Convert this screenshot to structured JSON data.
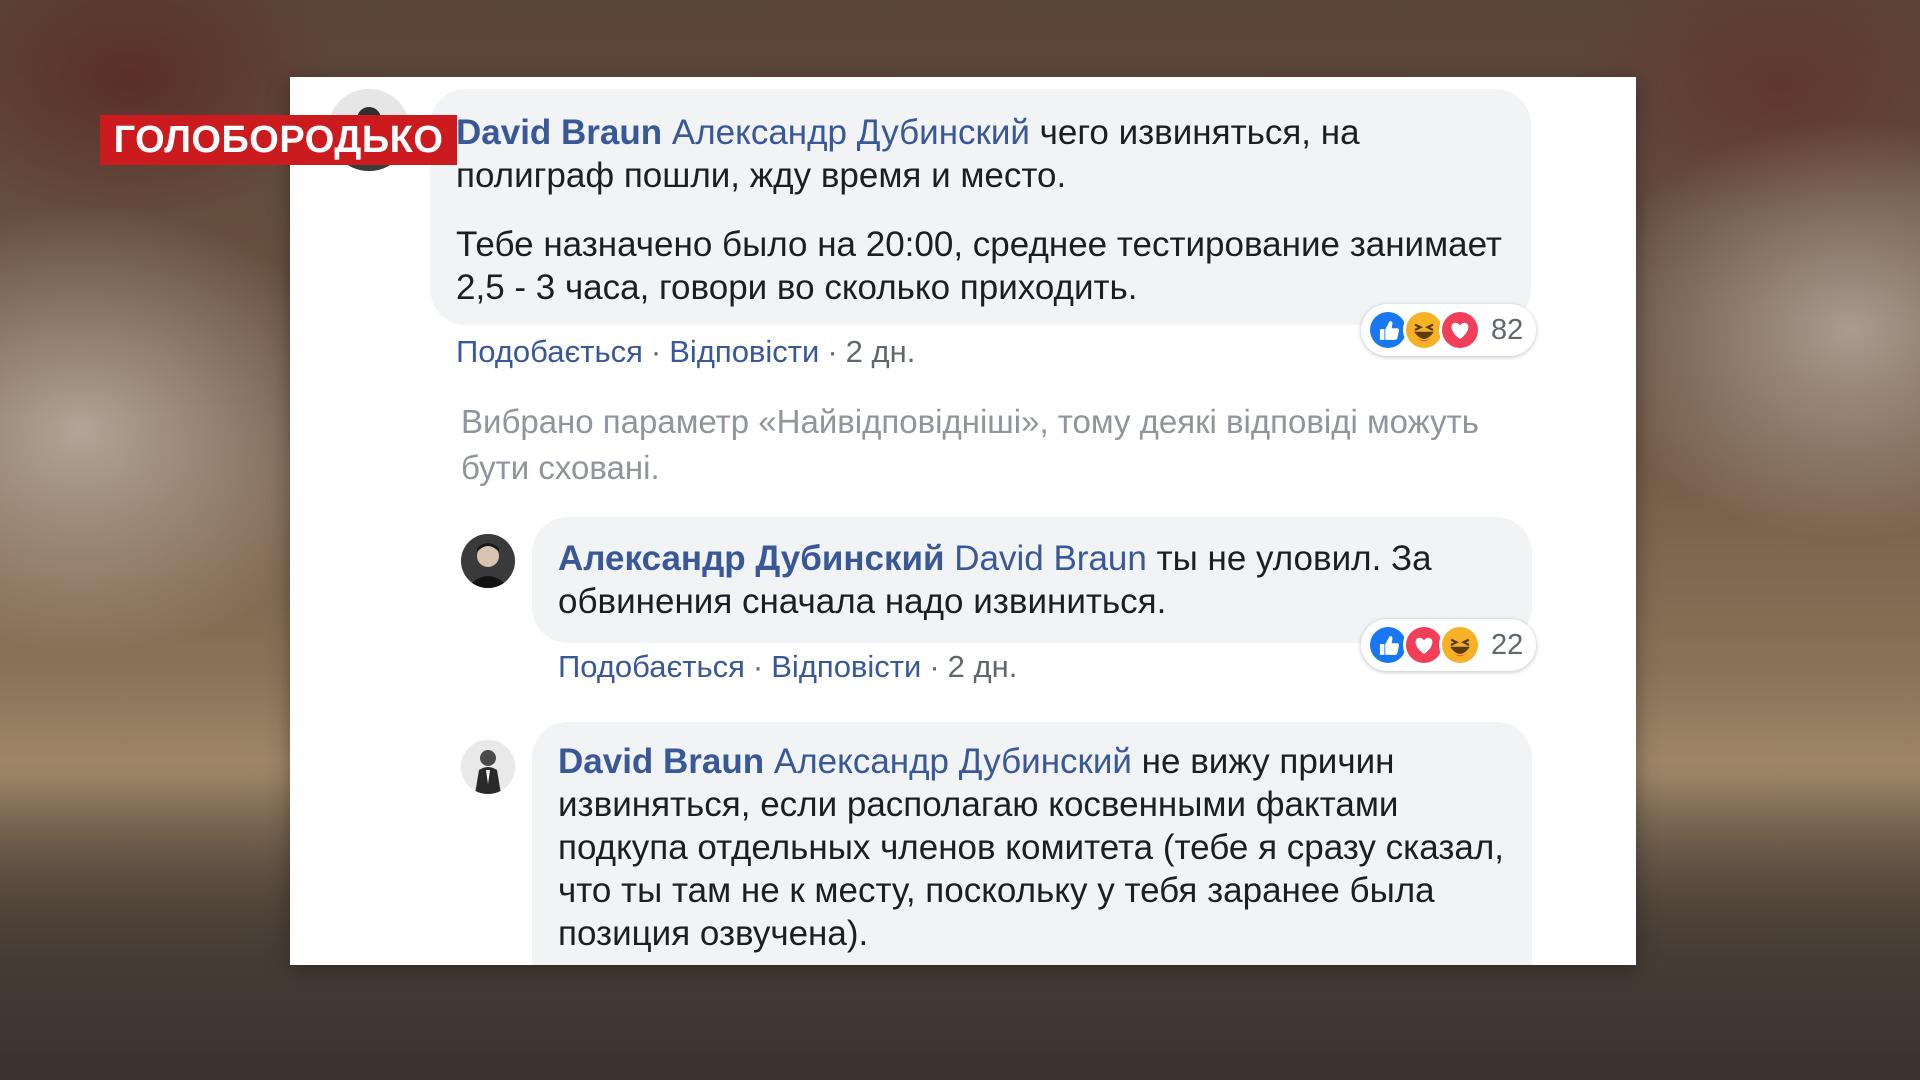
{
  "overlay": {
    "label": "ГОЛОБОРОДЬКО"
  },
  "comments": [
    {
      "author": "David Braun",
      "mention": "Александр Дубинский",
      "text": " чего извиняться, на полиграф пошли, жду время и место.",
      "text2": "Тебе назначено было на 20:00, среднее тестирование занимает 2,5 - 3 часа, говори во сколько приходить.",
      "like_label": "Подобається",
      "reply_label": "Відповісти",
      "time": "2 дн.",
      "reaction_icons": [
        "like-icon",
        "haha-icon",
        "love-icon"
      ],
      "reaction_count": "82"
    },
    {
      "author": "Александр Дубинский",
      "mention": "David Braun",
      "text": " ты не уловил. За обвинения сначала надо извиниться.",
      "like_label": "Подобається",
      "reply_label": "Відповісти",
      "time": "2 дн.",
      "reaction_icons": [
        "like-icon",
        "love-icon",
        "haha-icon"
      ],
      "reaction_count": "22"
    },
    {
      "author": "David Braun",
      "mention": "Александр Дубинский",
      "text": " не вижу причин извиняться, если располагаю косвенными фактами подкупа отдельных членов комитета (тебе я сразу сказал, что ты там не к месту, поскольку у тебя заранее была позиция озвучена)."
    }
  ],
  "notice": "Вибрано параметр «Найвідповідніші», тому деякі відповіді можуть бути сховані.",
  "colors": {
    "link": "#385898",
    "bubble": "#f2f3f5",
    "label_bg": "#cc1b1f",
    "like": "#1877f2",
    "love": "#f33e58",
    "haha": "#f7b125"
  }
}
